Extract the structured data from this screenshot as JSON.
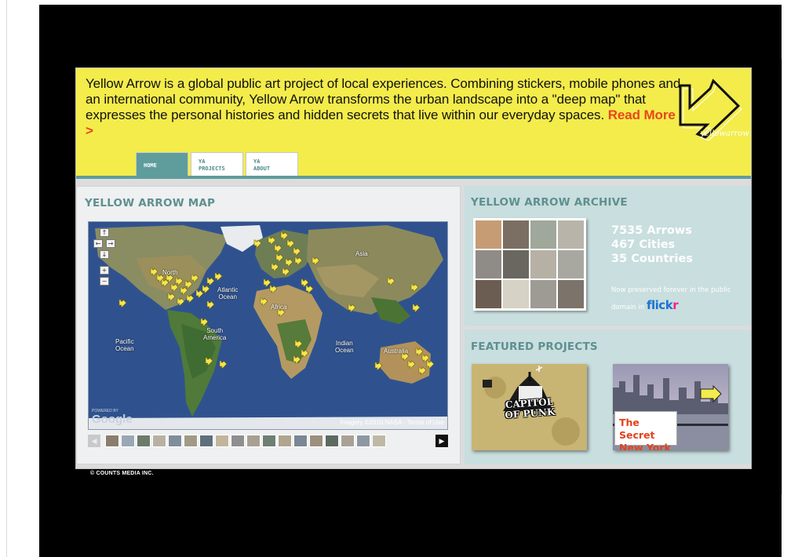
{
  "intro": {
    "text": "Yellow Arrow is a global public art project of local experiences. Combining stickers, mobile phones and an international community, Yellow Arrow transforms the urban landscape into a \"deep map\" that expresses the personal histories and hidden secrets that live within our everyday spaces.",
    "read_more": "Read More >"
  },
  "logo": {
    "wordmark": "yellowarrow"
  },
  "tabs": [
    {
      "line1": "HOME",
      "line2": ""
    },
    {
      "line1": "YA",
      "line2": "PROJECTS"
    },
    {
      "line1": "YA",
      "line2": "ABOUT"
    }
  ],
  "map_panel": {
    "title": "YELLOW ARROW MAP",
    "labels": {
      "north": "North",
      "atlantic": "Atlantic\nOcean",
      "asia": "Asia",
      "africa": "Africa",
      "pacific": "Pacific\nOcean",
      "south_america": "South\nAmerica",
      "indian": "Indian\nOcean",
      "australia": "Australia"
    },
    "powered_by": "POWERED BY",
    "google": "Google",
    "credit": "Imagery ©2010 NASA - Terms of Use",
    "controls": [
      "↑",
      "←",
      "→",
      "↓",
      "+",
      "−"
    ]
  },
  "archive_panel": {
    "title": "YELLOW ARROW ARCHIVE",
    "arrows": "7535 Arrows",
    "cities": "467 Cities",
    "countries": "35 Countries",
    "preserved": "Now preserved forever in the public domain in",
    "flickr_a": "flick",
    "flickr_b": "r"
  },
  "featured_panel": {
    "title": "FEATURED PROJECTS",
    "project_a": "CAPITOL OF PUNK",
    "project_b_line1": "The Secret",
    "project_b_line2": "New York"
  },
  "footer": {
    "text": "© COUNTS MEDIA INC."
  },
  "colors": {
    "header_yellow": "#f3ec4b",
    "teal": "#5f9c9c",
    "panel_teal": "#c9dede",
    "read_more": "#e8461c",
    "flickr_blue": "#1b74d3",
    "flickr_pink": "#ff1c8e"
  }
}
